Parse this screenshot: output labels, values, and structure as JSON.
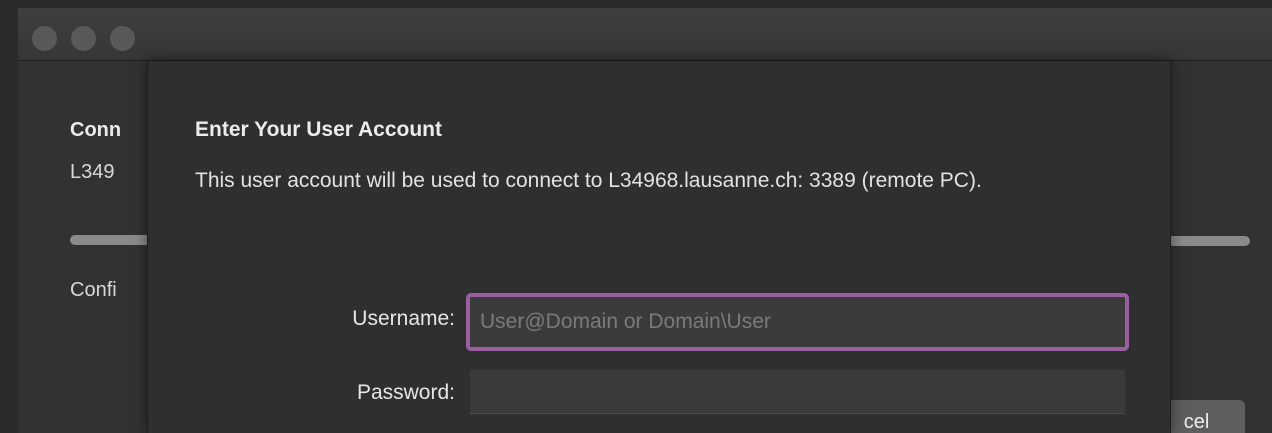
{
  "background_window": {
    "section_title": "Conn",
    "host": "L349",
    "status": "Confi",
    "cancel_label": "cel"
  },
  "sheet": {
    "title": "Enter Your User Account",
    "description": "This user account will be used to connect to L34968.lausanne.ch: 3389 (remote PC).",
    "username_label": "Username:",
    "username_value": "",
    "username_placeholder": "User@Domain or Domain\\User",
    "password_label": "Password:",
    "password_value": ""
  },
  "colors": {
    "focus_ring": "#9a5f9e",
    "window_background": "#323232"
  }
}
